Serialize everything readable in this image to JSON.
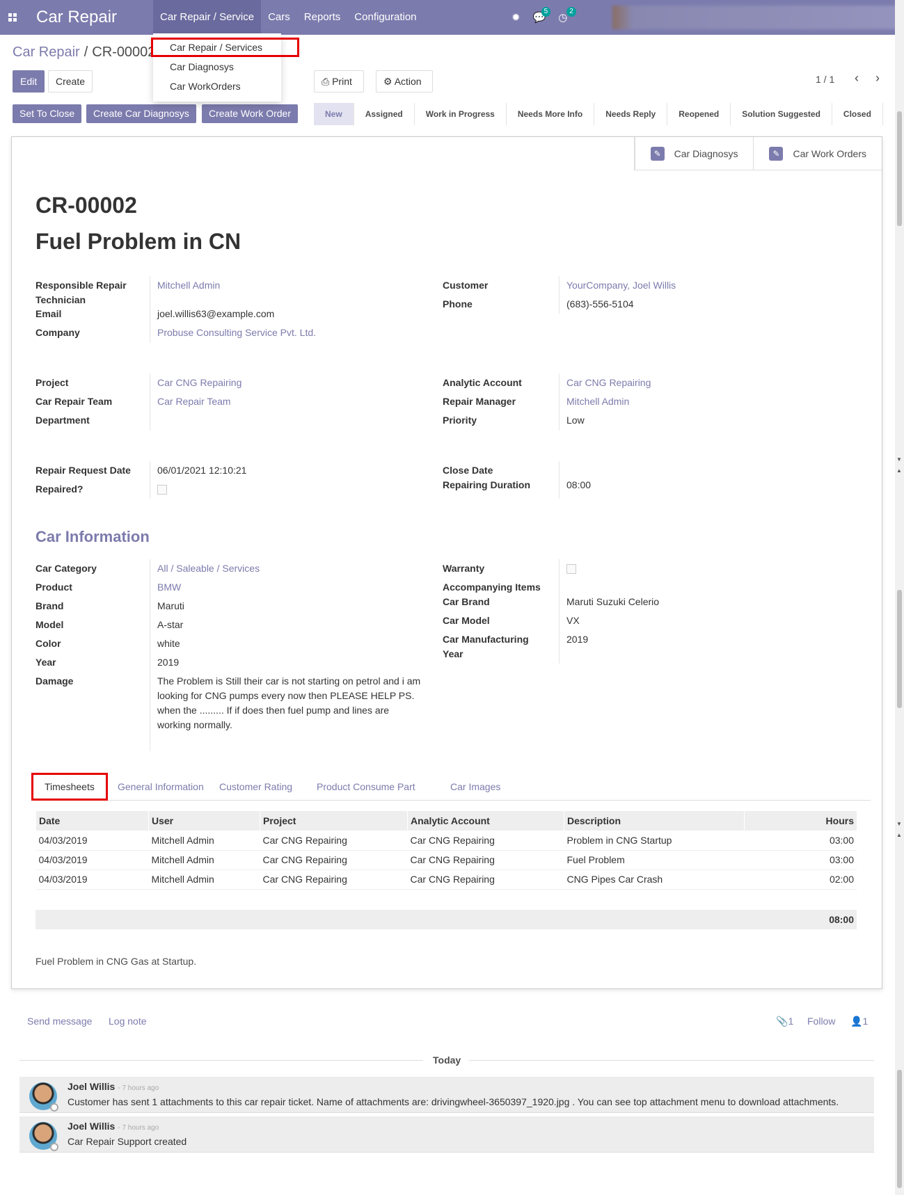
{
  "app": {
    "title": "Car Repair",
    "menu": [
      "Car Repair / Service",
      "Cars",
      "Reports",
      "Configuration"
    ],
    "messages_count": "5",
    "activities_count": "2"
  },
  "dropdown": [
    "Car Repair / Services",
    "Car Diagnosys",
    "Car WorkOrders"
  ],
  "breadcrumb": {
    "parent": "Car Repair",
    "current": "CR-00002"
  },
  "buttons": {
    "edit": "Edit",
    "create": "Create",
    "print": "Print",
    "action": "Action",
    "set_to_close": "Set To Close",
    "create_diag": "Create Car Diagnosys",
    "create_wo": "Create Work Order"
  },
  "pager": "1 / 1",
  "stages": [
    "New",
    "Assigned",
    "Work in Progress",
    "Needs More Info",
    "Needs Reply",
    "Reopened",
    "Solution Suggested",
    "Closed"
  ],
  "smart_buttons": [
    "Car Diagnosys",
    "Car Work Orders"
  ],
  "record": {
    "number": "CR-00002",
    "title": "Fuel Problem in CN"
  },
  "fields": {
    "tech_label": "Responsible Repair Technician",
    "tech": "Mitchell Admin",
    "email_label": "Email",
    "email": "joel.willis63@example.com",
    "company_label": "Company",
    "company": "Probuse Consulting Service Pvt. Ltd.",
    "customer_label": "Customer",
    "customer": "YourCompany, Joel Willis",
    "phone_label": "Phone",
    "phone": "(683)-556-5104",
    "project_label": "Project",
    "project": "Car CNG Repairing",
    "team_label": "Car Repair Team",
    "team": "Car Repair Team",
    "dept_label": "Department",
    "analytic_label": "Analytic Account",
    "analytic": "Car CNG Repairing",
    "manager_label": "Repair Manager",
    "manager": "Mitchell Admin",
    "priority_label": "Priority",
    "priority": "Low",
    "reqdate_label": "Repair Request Date",
    "reqdate": "06/01/2021 12:10:21",
    "repaired_label": "Repaired?",
    "closedate_label": "Close Date",
    "duration_label": "Repairing Duration",
    "duration": "08:00"
  },
  "car": {
    "section": "Car Information",
    "category_label": "Car Category",
    "category": "All / Saleable / Services",
    "product_label": "Product",
    "product": "BMW",
    "brand_label": "Brand",
    "brand": "Maruti",
    "model_label": "Model",
    "model": "A-star",
    "color_label": "Color",
    "color": "white",
    "year_label": "Year",
    "year": "2019",
    "damage_label": "Damage",
    "damage": "The Problem is Still their car is not starting on petrol and i am looking for CNG pumps every now then PLEASE HELP PS. when the ......... If if does then fuel pump and lines are working normally.",
    "warranty_label": "Warranty",
    "accomp_label": "Accompanying Items",
    "carbrand_label": "Car Brand",
    "carbrand": "Maruti Suzuki Celerio",
    "carmodel_label": "Car Model",
    "carmodel": "VX",
    "mfgyear_label": "Car Manufacturing Year",
    "mfgyear": "2019"
  },
  "tabs": [
    "Timesheets",
    "General Information",
    "Customer Rating",
    "Product Consume Part",
    "Car Images"
  ],
  "timesheet": {
    "headers": [
      "Date",
      "User",
      "Project",
      "Analytic Account",
      "Description",
      "Hours"
    ],
    "rows": [
      [
        "04/03/2019",
        "Mitchell Admin",
        "Car CNG Repairing",
        "Car CNG Repairing",
        "Problem in CNG Startup",
        "03:00"
      ],
      [
        "04/03/2019",
        "Mitchell Admin",
        "Car CNG Repairing",
        "Car CNG Repairing",
        "Fuel Problem",
        "03:00"
      ],
      [
        "04/03/2019",
        "Mitchell Admin",
        "Car CNG Repairing",
        "Car CNG Repairing",
        "CNG Pipes Car Crash",
        "02:00"
      ]
    ],
    "total": "08:00"
  },
  "note": "Fuel Problem in CNG Gas at Startup.",
  "chatter": {
    "send": "Send message",
    "log": "Log note",
    "attachments": "1",
    "follow": "Follow",
    "followers": "1",
    "today": "Today",
    "messages": [
      {
        "author": "Joel Willis",
        "time": "- 7 hours ago",
        "body": "Customer has sent 1 attachments to this car repair ticket. Name of attachments are: drivingwheel-3650397_1920.jpg . You can see top attachment menu to download attachments."
      },
      {
        "author": "Joel Willis",
        "time": "- 7 hours ago",
        "body": "Car Repair Support created"
      }
    ]
  }
}
